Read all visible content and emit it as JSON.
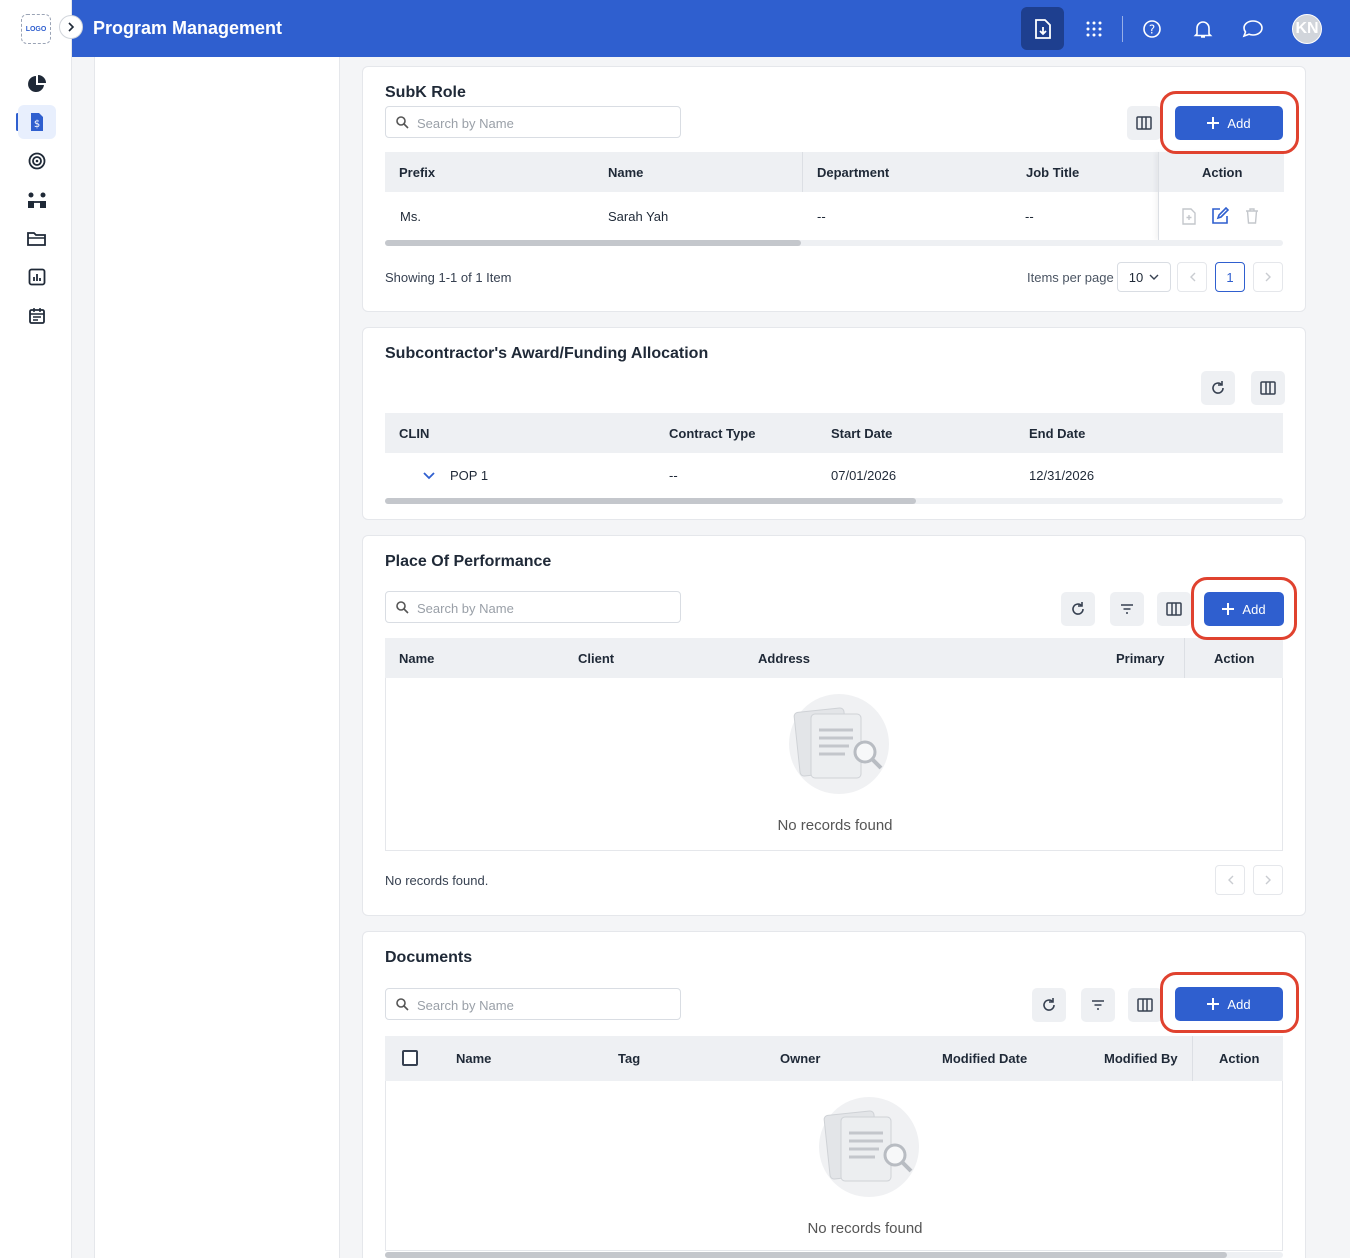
{
  "app": {
    "logo_text": "LOGO",
    "title": "Program Management",
    "avatar_initials": "KN",
    "accent": "#2f5fcf",
    "highlight": "#e0422f"
  },
  "topbar": {
    "icons": [
      "file-download-icon",
      "apps-grid-icon",
      "help-icon",
      "bell-icon",
      "chat-icon"
    ]
  },
  "sidebar": {
    "items": [
      {
        "icon": "pie-chart-icon"
      },
      {
        "icon": "dollar-file-icon",
        "active": true
      },
      {
        "icon": "target-icon"
      },
      {
        "icon": "team-icon"
      },
      {
        "icon": "folder-icon"
      },
      {
        "icon": "report-icon"
      },
      {
        "icon": "calendar-icon"
      }
    ]
  },
  "subk_role": {
    "title": "SubK Role",
    "search_placeholder": "Search by Name",
    "add_label": "Add",
    "columns": [
      "Prefix",
      "Name",
      "Department",
      "Job Title",
      "Action"
    ],
    "rows": [
      {
        "prefix": "Ms.",
        "name": "Sarah Yah",
        "department": "--",
        "job_title": "--"
      }
    ],
    "showing": "Showing 1-1 of 1 Item",
    "items_per_page_label": "Items per page",
    "items_per_page": "10",
    "current_page": "1"
  },
  "award": {
    "title": "Subcontractor's Award/Funding Allocation",
    "columns": [
      "CLIN",
      "Contract Type",
      "Start Date",
      "End Date"
    ],
    "rows": [
      {
        "clin": "POP 1",
        "contract_type": "--",
        "start": "07/01/2026",
        "end": "12/31/2026"
      }
    ]
  },
  "place": {
    "title": "Place Of Performance",
    "search_placeholder": "Search by Name",
    "add_label": "Add",
    "columns": [
      "Name",
      "Client",
      "Address",
      "Primary",
      "Action"
    ],
    "empty_text": "No records found",
    "footer_text": "No records found."
  },
  "documents": {
    "title": "Documents",
    "search_placeholder": "Search by Name",
    "add_label": "Add",
    "columns": [
      "Name",
      "Tag",
      "Owner",
      "Modified Date",
      "Modified By",
      "Action"
    ],
    "empty_text": "No records found"
  }
}
